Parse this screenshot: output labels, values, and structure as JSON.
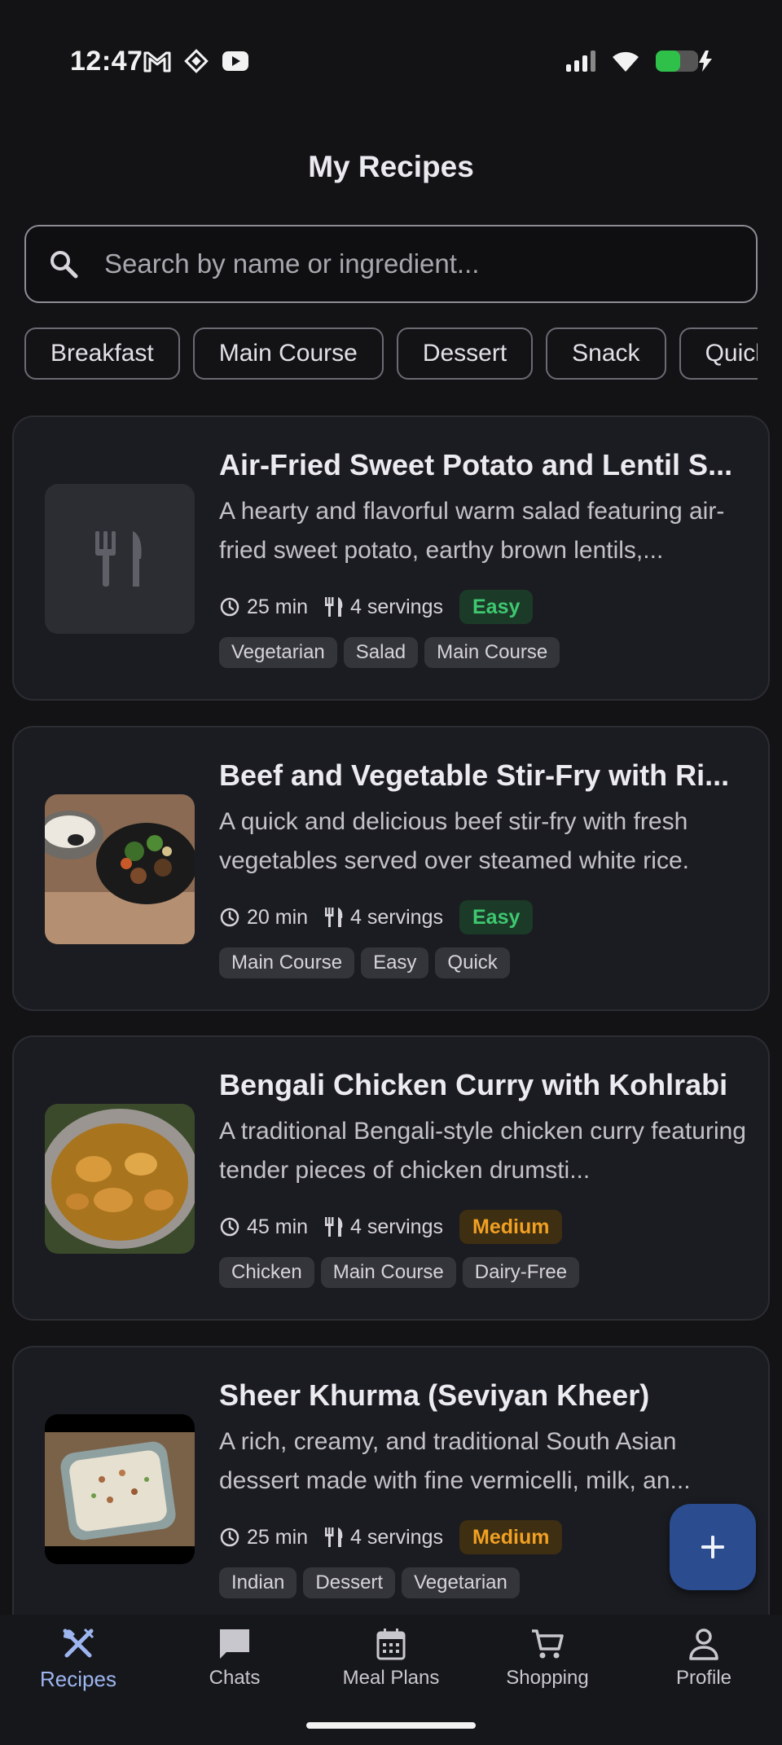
{
  "status_bar": {
    "time": "12:47",
    "left_icons": [
      "gmail-icon",
      "app-icon",
      "youtube-icon"
    ],
    "right_icons": [
      "signal-icon",
      "wifi-icon",
      "battery-charging-icon"
    ]
  },
  "header": {
    "title": "My Recipes"
  },
  "search": {
    "placeholder": "Search by name or ingredient...",
    "value": ""
  },
  "categories": [
    "Breakfast",
    "Main Course",
    "Dessert",
    "Snack",
    "Quick"
  ],
  "recipes": [
    {
      "title": "Air-Fried Sweet Potato and Lentil S...",
      "description": "A hearty and flavorful warm salad featuring air-fried sweet potato, earthy brown lentils,...",
      "time": "25 min",
      "servings": "4 servings",
      "difficulty": "Easy",
      "tags": [
        "Vegetarian",
        "Salad",
        "Main Course"
      ],
      "thumbnail": "placeholder-utensils-icon"
    },
    {
      "title": "Beef and Vegetable Stir-Fry with Ri...",
      "description": "A quick and delicious beef stir-fry with fresh vegetables served over steamed white rice.",
      "time": "20 min",
      "servings": "4 servings",
      "difficulty": "Easy",
      "tags": [
        "Main Course",
        "Easy",
        "Quick"
      ],
      "thumbnail": "stir-fry-photo"
    },
    {
      "title": "Bengali Chicken Curry with Kohlrabi",
      "description": "A traditional Bengali-style chicken curry featuring tender pieces of chicken drumsti...",
      "time": "45 min",
      "servings": "4 servings",
      "difficulty": "Medium",
      "tags": [
        "Chicken",
        "Main Course",
        "Dairy-Free"
      ],
      "thumbnail": "curry-photo"
    },
    {
      "title": "Sheer Khurma (Seviyan Kheer)",
      "description": "A rich, creamy, and traditional South Asian dessert made with fine vermicelli, milk, an...",
      "time": "25 min",
      "servings": "4 servings",
      "difficulty": "Medium",
      "tags": [
        "Indian",
        "Dessert",
        "Vegetarian"
      ],
      "thumbnail": "kheer-photo"
    }
  ],
  "fab": {
    "icon": "plus-icon"
  },
  "bottom_nav": [
    {
      "label": "Recipes",
      "icon": "utensils-crossed-icon",
      "active": true
    },
    {
      "label": "Chats",
      "icon": "chat-icon",
      "active": false
    },
    {
      "label": "Meal Plans",
      "icon": "calendar-icon",
      "active": false
    },
    {
      "label": "Shopping",
      "icon": "cart-icon",
      "active": false
    },
    {
      "label": "Profile",
      "icon": "person-icon",
      "active": false
    }
  ],
  "colors": {
    "background": "#131316",
    "card": "#1b1c21",
    "accent": "#2b4c8f",
    "easy": "#3ec870",
    "medium": "#f0a022",
    "nav_active": "#9db6f0"
  }
}
